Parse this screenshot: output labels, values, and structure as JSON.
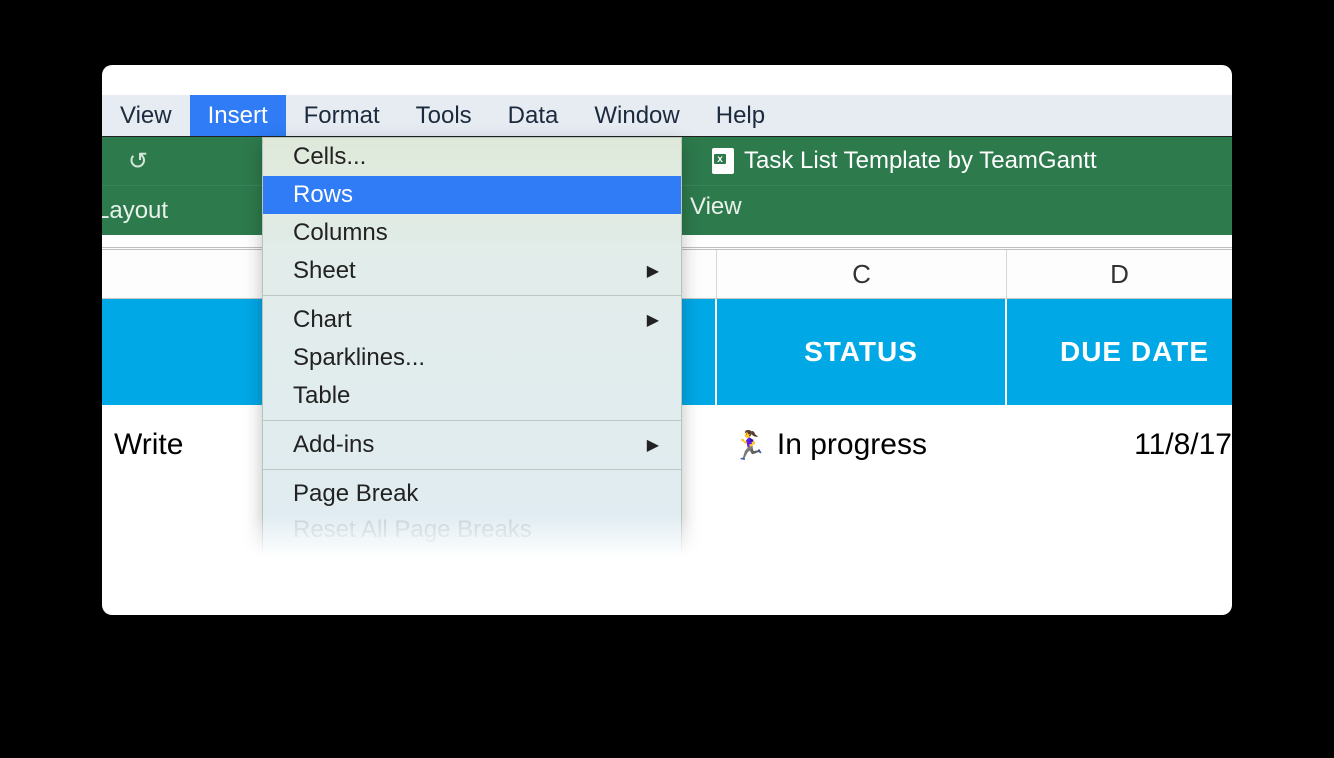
{
  "menu": {
    "items": [
      "View",
      "Insert",
      "Format",
      "Tools",
      "Data",
      "Window",
      "Help"
    ],
    "active_index": 1
  },
  "dropdown": {
    "groups": [
      [
        {
          "label": "Cells...",
          "submenu": false
        },
        {
          "label": "Rows",
          "submenu": false,
          "highlighted": true
        },
        {
          "label": "Columns",
          "submenu": false
        },
        {
          "label": "Sheet",
          "submenu": true
        }
      ],
      [
        {
          "label": "Chart",
          "submenu": true
        },
        {
          "label": "Sparklines...",
          "submenu": false
        },
        {
          "label": "Table",
          "submenu": false
        }
      ],
      [
        {
          "label": "Add-ins",
          "submenu": true
        }
      ],
      [
        {
          "label": "Page Break",
          "submenu": false
        },
        {
          "label": "Reset All Page Breaks",
          "submenu": false,
          "cutoff": true
        }
      ]
    ]
  },
  "toolbar": {
    "document_title": "Task List Template by TeamGantt",
    "layout_label": "Layout",
    "view_label": "View"
  },
  "columns": {
    "c": "C",
    "d": "D"
  },
  "headers": {
    "status": "STATUS",
    "due_date": "DUE DATE"
  },
  "row": {
    "task": "Write",
    "status_emoji": "🏃‍♀️",
    "status_text": "In progress",
    "due_date": "11/8/17"
  }
}
